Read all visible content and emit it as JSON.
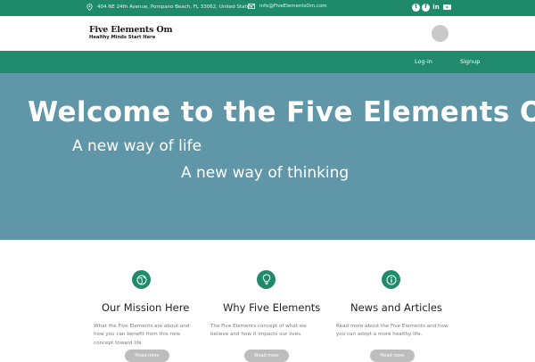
{
  "topbar": {
    "address": "404 NE 24th Avenue, Pompano Beach, FL 33062, United States",
    "email": "info@FiveElementsOm.com",
    "social": [
      {
        "icon": "twitter-icon",
        "glyph": "t"
      },
      {
        "icon": "facebook-icon",
        "glyph": "f"
      },
      {
        "icon": "linkedin-icon",
        "glyph": "in"
      },
      {
        "icon": "youtube-icon",
        "glyph": "▶"
      }
    ]
  },
  "header": {
    "brand": "Five Elements Om",
    "tagline": "Healthy Minds Start Here"
  },
  "nav": {
    "login": "Log-in",
    "signup": "Signup"
  },
  "hero": {
    "title": "Welcome to the Five Elements Om",
    "line1": "A new way of life",
    "line2": "A new way of thinking"
  },
  "features": [
    {
      "icon": "globe-icon",
      "title": "Our Mission Here",
      "text": "What the Five Elements are about and how you can benefit from this new concept toward life",
      "button": "Read more"
    },
    {
      "icon": "lightbulb-icon",
      "title": "Why Five Elements",
      "text": "The Five Elements concept of what we believe and how it impacts our lives.",
      "button": "Read more"
    },
    {
      "icon": "info-icon",
      "title": "News and Articles",
      "text": "Read more about the Five Elements and how you can adopt a more healthy life.",
      "button": "Read more"
    }
  ],
  "colors": {
    "brand_green": "#1f8a6c",
    "hero_blue": "#5f97a8"
  }
}
